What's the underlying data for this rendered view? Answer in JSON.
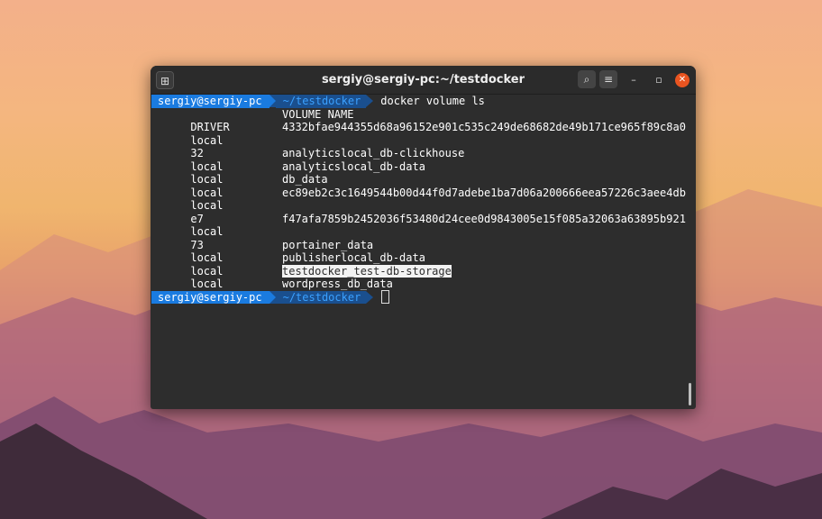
{
  "window": {
    "title": "sergiy@sergiy-pc:~/testdocker",
    "new_tab_icon": "new-tab-icon",
    "search_icon": "search-icon",
    "menu_icon": "hamburger-icon",
    "minimize": "–",
    "maximize": "▫",
    "close": "✕"
  },
  "prompt": {
    "user": "sergiy@sergiy-pc",
    "dir": "~/testdocker",
    "command": "docker volume ls"
  },
  "output": {
    "header": {
      "driver": "DRIVER",
      "name": "VOLUME NAME"
    },
    "rows": [
      {
        "driver": "local",
        "name": "4332bfae944355d68a96152e901c535c249de68682de49b171ce965f89c8a0",
        "wrap": "32"
      },
      {
        "driver": "local",
        "name": "analyticslocal_db-clickhouse",
        "wrap": ""
      },
      {
        "driver": "local",
        "name": "analyticslocal_db-data",
        "wrap": ""
      },
      {
        "driver": "local",
        "name": "db_data",
        "wrap": ""
      },
      {
        "driver": "local",
        "name": "ec89eb2c3c1649544b00d44f0d7adebe1ba7d06a200666eea57226c3aee4db",
        "wrap": "e7"
      },
      {
        "driver": "local",
        "name": "f47afa7859b2452036f53480d24cee0d9843005e15f085a32063a63895b921",
        "wrap": "73"
      },
      {
        "driver": "local",
        "name": "portainer_data",
        "wrap": ""
      },
      {
        "driver": "local",
        "name": "publisherlocal_db-data",
        "wrap": ""
      },
      {
        "driver": "local",
        "name": "testdocker_test-db-storage",
        "wrap": "",
        "highlighted": true
      },
      {
        "driver": "local",
        "name": "wordpress_db_data",
        "wrap": ""
      }
    ]
  },
  "colors": {
    "prompt_user_bg": "#1a7be0",
    "prompt_dir_bg": "#1a4f8e",
    "terminal_bg": "#2d2d2d",
    "close_button": "#e95420"
  }
}
